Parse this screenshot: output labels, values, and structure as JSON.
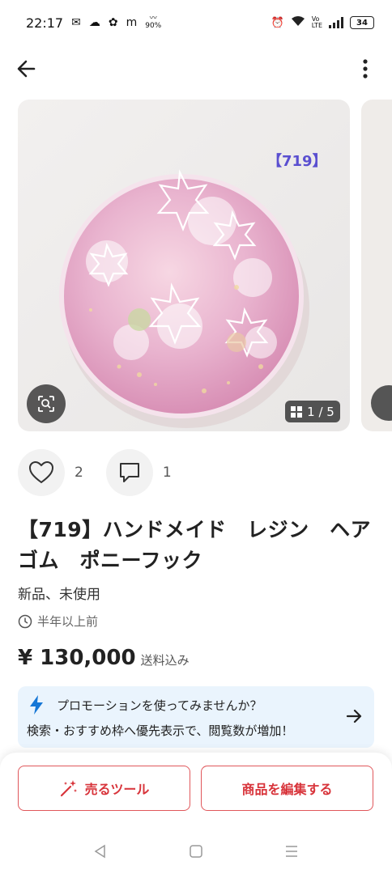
{
  "status_bar": {
    "time": "22:17",
    "left_icons": [
      "notification-icon",
      "weather-icon",
      "network-icon",
      "m-icon",
      "aqi-icon"
    ],
    "aqi": "90%",
    "battery": "34"
  },
  "gallery": {
    "current": "1",
    "total": "5",
    "counter": "1 / 5",
    "item_tag": "【719】"
  },
  "social": {
    "likes": "2",
    "comments": "1"
  },
  "item": {
    "title": "【719】ハンドメイド　レジン　ヘアゴム　ポニーフック",
    "condition": "新品、未使用",
    "listed": "半年以上前",
    "price": "¥ 130,000",
    "shipping": "送料込み"
  },
  "promo": {
    "title": "プロモーションを使ってみませんか？",
    "description": "検索・おすすめ枠へ優先表示で、閲覧数が増加！"
  },
  "actions": {
    "sell_tools": "売るツール",
    "edit_item": "商品を編集する"
  },
  "colors": {
    "accent_red": "#d8343b",
    "promo_bg": "#eaf4fd",
    "bolt_blue": "#1677d6"
  }
}
